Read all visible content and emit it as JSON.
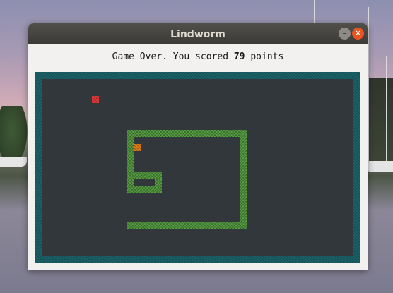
{
  "window": {
    "title": "Lindworm",
    "minimize_glyph": "–",
    "close_glyph": "✕"
  },
  "status": {
    "prefix": "Game Over. You scored ",
    "score": "79",
    "suffix": " points"
  },
  "colors": {
    "snake": "#58a044",
    "food": "#e23a3a",
    "head": "#e07b1c",
    "field": "#31373a",
    "border": "#1a6066"
  },
  "game": {
    "state": "game over",
    "score": 79,
    "grid_cell_units": 10
  }
}
